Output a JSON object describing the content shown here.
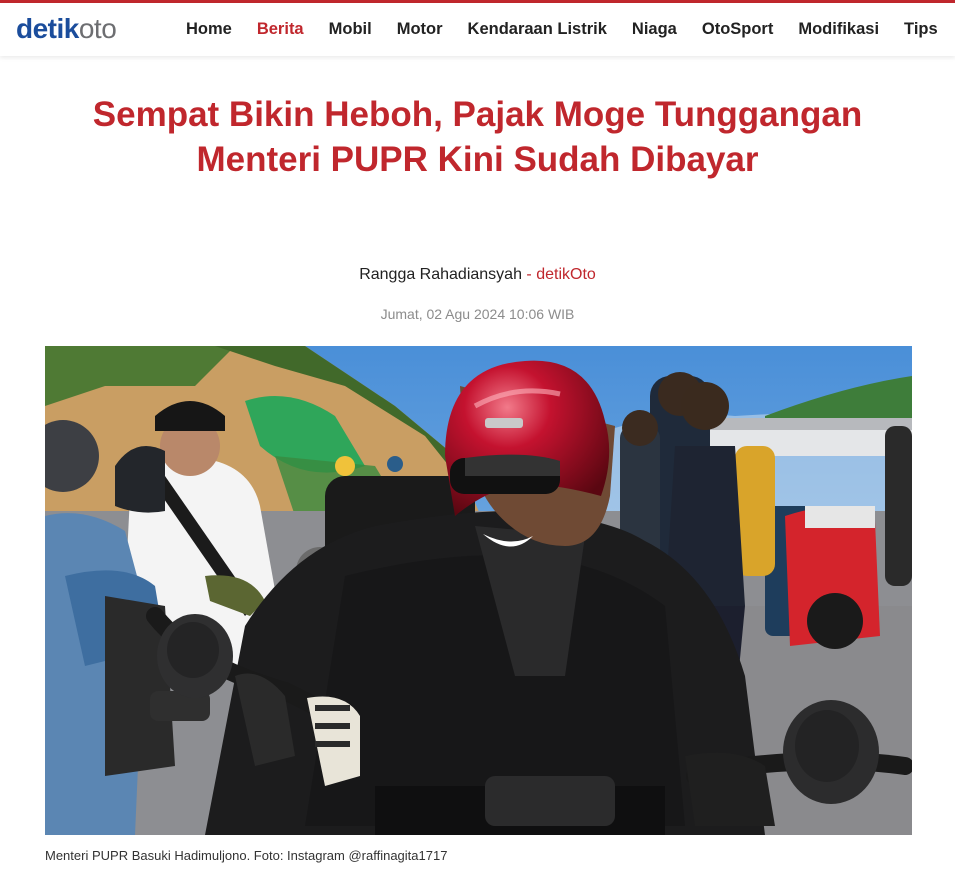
{
  "site": {
    "logo_part1": "detik",
    "logo_part2": "oto"
  },
  "nav": [
    "Home",
    "Berita",
    "Mobil",
    "Motor",
    "Kendaraan Listrik",
    "Niaga",
    "OtoSport",
    "Modifikasi",
    "Tips"
  ],
  "active_nav": "Berita",
  "article": {
    "title": "Sempat Bikin Heboh, Pajak Moge Tunggangan Menteri PUPR Kini Sudah Dibayar",
    "author": "Rangga Rahadiansyah",
    "separator": " - ",
    "source": "detikOto",
    "date": "Jumat, 02 Agu 2024 10:06 WIB",
    "caption": "Menteri PUPR Basuki Hadimuljono. Foto: Instagram @raffinagita1717"
  },
  "colors": {
    "accent": "#c0272d",
    "logo_blue": "#1b4d9c",
    "logo_gray": "#6d6e71"
  }
}
